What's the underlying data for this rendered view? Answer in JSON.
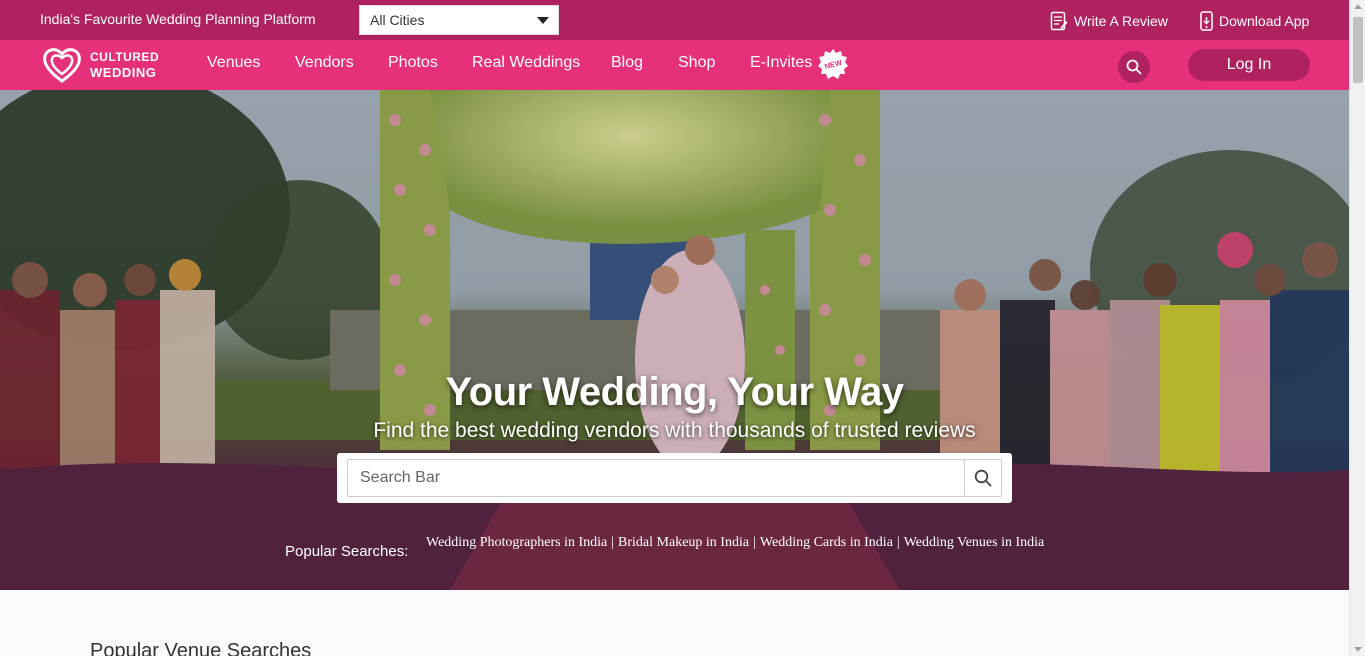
{
  "topbar": {
    "tagline": "India's Favourite Wedding Planning Platform",
    "city_select": "All Cities",
    "write_review": "Write A Review",
    "download_app": "Download App"
  },
  "brand": {
    "line1": "CULTURED",
    "line2": "WEDDING",
    "primary_color": "#e6307a",
    "dark_color": "#b0225f"
  },
  "nav": {
    "items": [
      {
        "label": "Venues"
      },
      {
        "label": "Vendors"
      },
      {
        "label": "Photos"
      },
      {
        "label": "Real Weddings"
      },
      {
        "label": "Blog"
      },
      {
        "label": "Shop"
      },
      {
        "label": "E-Invites"
      }
    ],
    "new_badge": "NEW",
    "login": "Log In"
  },
  "hero": {
    "title": "Your Wedding, Your Way",
    "subtitle": "Find the best wedding vendors with thousands of trusted reviews",
    "search_placeholder": "Search Bar",
    "popular_label": "Popular Searches:",
    "popular": [
      "Wedding Photographers in India",
      "Bridal Makeup in India",
      "Wedding Cards in India",
      "Wedding Venues in India"
    ]
  },
  "section": {
    "title": "Popular Venue Searches"
  },
  "icons": [
    "review-icon",
    "phone-icon",
    "heart-logo-icon",
    "new-badge-icon",
    "search-icon"
  ]
}
